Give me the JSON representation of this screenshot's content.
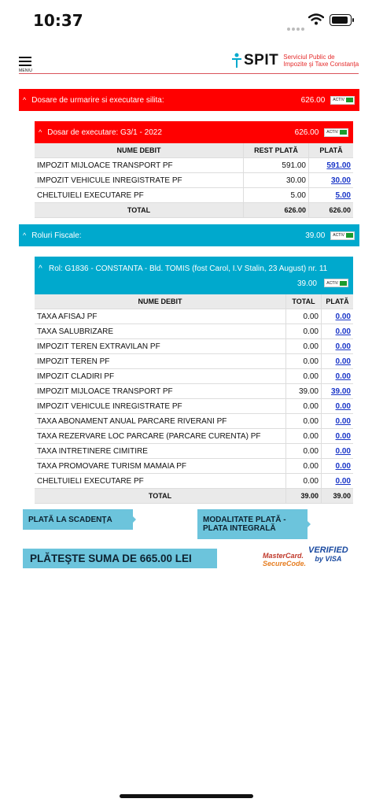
{
  "status": {
    "time": "10:37"
  },
  "header": {
    "menu_label": "MENIU",
    "logo_name": "SPIT",
    "logo_sub_line1": "Serviciul Public de",
    "logo_sub_line2": "Impozite şi Taxe Constanţa"
  },
  "badge_label": "ACTIV",
  "colors": {
    "red_panel": "#ff0000",
    "blue_panel": "#00a9cd",
    "button": "#6cc4dc",
    "link": "#1a36c8",
    "header_line": "#d9545c"
  },
  "dosare": {
    "title": "Dosare de urmarire si executare silita:",
    "amount": "626.00",
    "sub": {
      "title": "Dosar de executare: G3/1 - 2022",
      "amount": "626.00",
      "columns": [
        "NUME DEBIT",
        "REST PLATĂ",
        "PLATĂ"
      ],
      "rows": [
        {
          "name": "IMPOZIT MIJLOACE TRANSPORT PF",
          "rest": "591.00",
          "pay": "591.00"
        },
        {
          "name": "IMPOZIT VEHICULE INREGISTRATE PF",
          "rest": "30.00",
          "pay": "30.00"
        },
        {
          "name": "CHELTUIELI EXECUTARE PF",
          "rest": "5.00",
          "pay": "5.00"
        }
      ],
      "total_label": "TOTAL",
      "total_rest": "626.00",
      "total_pay": "626.00"
    }
  },
  "roluri": {
    "title": "Roluri Fiscale:",
    "amount": "39.00",
    "sub": {
      "title": "Rol: G1836 - CONSTANTA - Bld. TOMIS (fost Carol, I.V Stalin, 23 August) nr. 11",
      "amount": "39.00",
      "columns": [
        "NUME DEBIT",
        "TOTAL",
        "PLATĂ"
      ],
      "rows": [
        {
          "name": "TAXA AFISAJ PF",
          "total": "0.00",
          "pay": "0.00"
        },
        {
          "name": "TAXA SALUBRIZARE",
          "total": "0.00",
          "pay": "0.00"
        },
        {
          "name": "IMPOZIT TEREN EXTRAVILAN PF",
          "total": "0.00",
          "pay": "0.00"
        },
        {
          "name": "IMPOZIT TEREN PF",
          "total": "0.00",
          "pay": "0.00"
        },
        {
          "name": "IMPOZIT CLADIRI PF",
          "total": "0.00",
          "pay": "0.00"
        },
        {
          "name": "IMPOZIT MIJLOACE TRANSPORT PF",
          "total": "39.00",
          "pay": "39.00"
        },
        {
          "name": "IMPOZIT VEHICULE INREGISTRATE PF",
          "total": "0.00",
          "pay": "0.00"
        },
        {
          "name": "TAXA ABONAMENT ANUAL PARCARE RIVERANI PF",
          "total": "0.00",
          "pay": "0.00"
        },
        {
          "name": "TAXA REZERVARE LOC PARCARE (PARCARE CURENTA) PF",
          "total": "0.00",
          "pay": "0.00"
        },
        {
          "name": "TAXA INTRETINERE CIMITIRE",
          "total": "0.00",
          "pay": "0.00"
        },
        {
          "name": "TAXA PROMOVARE TURISM MAMAIA PF",
          "total": "0.00",
          "pay": "0.00"
        },
        {
          "name": "CHELTUIELI EXECUTARE PF",
          "total": "0.00",
          "pay": "0.00"
        }
      ],
      "total_label": "TOTAL",
      "total_total": "39.00",
      "total_pay": "39.00"
    }
  },
  "actions": {
    "plata_scadenta": "PLATĂ LA SCADENŢA",
    "modalitate_line1": "MODALITATE PLATĂ -",
    "modalitate_line2": "PLATA INTEGRALĂ",
    "pay_total": "PLĂTEŞTE SUMA DE 665.00 LEI",
    "mastercard_line1": "MasterCard.",
    "mastercard_line2": "SecureCode.",
    "visa_line1": "VERIFIED",
    "visa_line2": "by VISA"
  }
}
